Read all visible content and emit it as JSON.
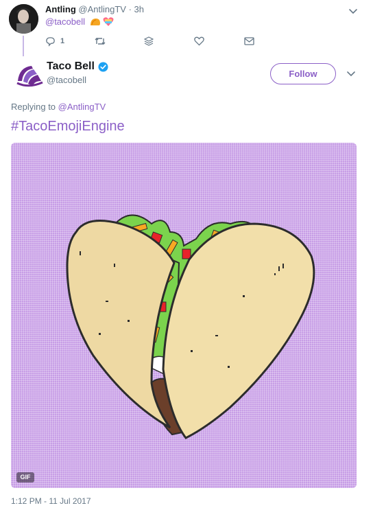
{
  "parent_tweet": {
    "author_name": "Antling",
    "author_handle": "@AntlingTV",
    "separator": "·",
    "time_ago": "3h",
    "body_mention": "@tacobell",
    "emojis": [
      "taco-emoji",
      "heart-emoji"
    ],
    "actions": {
      "reply_icon": "reply-icon",
      "reply_count": "1",
      "retweet_icon": "retweet-icon",
      "stack_icon": "stack-icon",
      "like_icon": "heart-outline-icon",
      "dm_icon": "envelope-icon"
    }
  },
  "main_tweet": {
    "author_name": "Taco Bell",
    "author_handle": "@tacobell",
    "verified_icon": "verified-badge-icon",
    "follow_label": "Follow",
    "menu_icon": "chevron-down-icon",
    "reply_prefix": "Replying to ",
    "reply_mention": "@AntlingTV",
    "hashtag": "#TacoEmojiEngine",
    "media": {
      "type": "gif",
      "badge": "GIF",
      "subject": "taco-heart-illustration"
    },
    "timestamp": "1:12 PM - 11 Jul 2017"
  },
  "colors": {
    "accent": "#8b5fc7",
    "media_bg": "#c79de6",
    "verified": "#1da1f2",
    "muted_text": "#657786"
  }
}
